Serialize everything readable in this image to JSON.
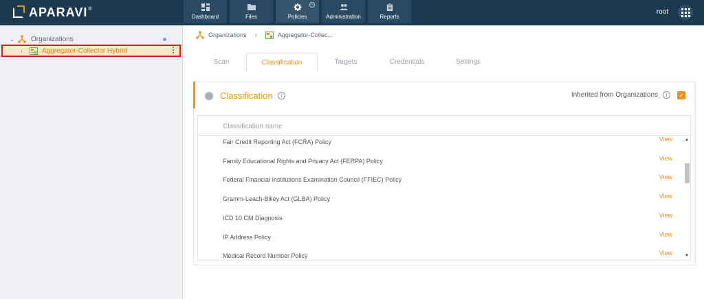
{
  "app": {
    "logo_text": "APARAVI",
    "logo_reg": "®"
  },
  "nav": [
    {
      "label": "Dashboard",
      "icon": "dashboard-icon",
      "active": false
    },
    {
      "label": "Files",
      "icon": "folder-icon",
      "active": false
    },
    {
      "label": "Policies",
      "icon": "gear-icon",
      "active": true
    },
    {
      "label": "Administration",
      "icon": "users-icon",
      "active": false
    },
    {
      "label": "Reports",
      "icon": "clipboard-icon",
      "active": false
    }
  ],
  "user": {
    "name": "root"
  },
  "sidebar": {
    "org_label": "Organizations",
    "selected_node": "Aggregator-Collector Hybrid"
  },
  "breadcrumb": {
    "items": [
      "Organizations",
      "Aggregator-Collec..."
    ]
  },
  "tabs": [
    {
      "label": "Scan",
      "active": false
    },
    {
      "label": "Classification",
      "active": true
    },
    {
      "label": "Targets",
      "active": false
    },
    {
      "label": "Credentials",
      "active": false
    },
    {
      "label": "Settings",
      "active": false
    }
  ],
  "panel": {
    "title": "Classification",
    "inherited_label": "Inherited from Organizations",
    "inherited_checked": true,
    "column_header": "Classification name",
    "view_label": "View",
    "rows": [
      "Fair Credit Reporting Act (FCRA) Policy",
      "Family Educational Rights and Privacy Act (FERPA) Policy",
      "Federal Financial Institutions Examination Council (FFIEC) Policy",
      "Gramm-Leach-Bliley Act (GLBA) Policy",
      "ICD 10 CM Diagnosis",
      "IP Address Policy",
      "Medical Record Number Policy"
    ]
  },
  "colors": {
    "accent": "#f0921a",
    "topbar": "#1b3a52",
    "highlight_border": "#e01b24"
  }
}
